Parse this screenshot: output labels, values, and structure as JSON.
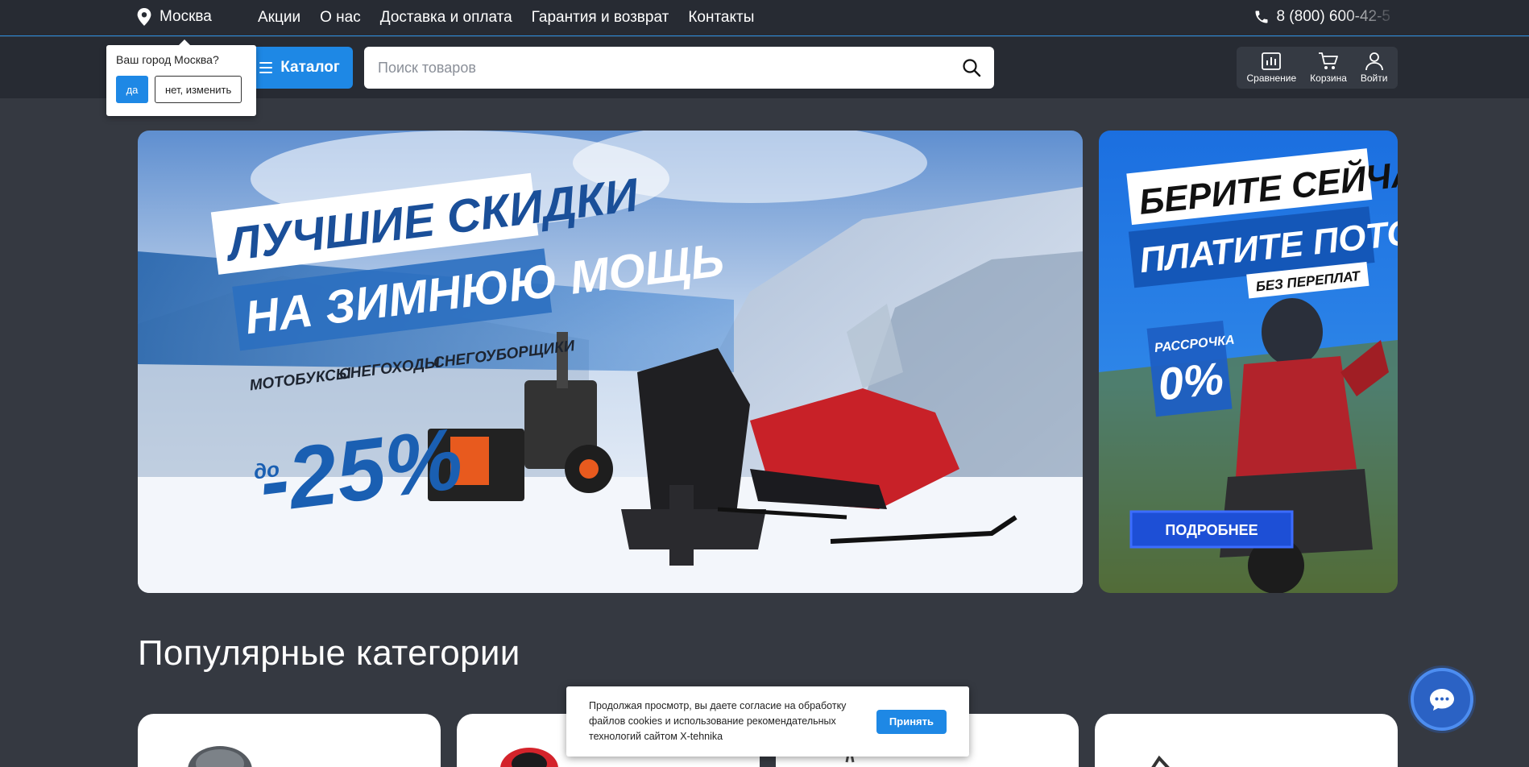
{
  "topbar": {
    "city": "Москва",
    "nav": [
      "Акции",
      "О нас",
      "Доставка и оплата",
      "Гарантия и возврат",
      "Контакты"
    ],
    "phone": "8 (800) 600-42-5"
  },
  "header": {
    "catalog_label": "Каталог",
    "search_placeholder": "Поиск товаров",
    "tools": [
      "Сравнение",
      "Корзина",
      "Войти"
    ]
  },
  "city_popup": {
    "question": "Ваш город Москва?",
    "yes_label": "да",
    "change_label": "нет, изменить"
  },
  "banner_main": {
    "line1": "ЛУЧШИЕ СКИДКИ",
    "line2": "НА ЗИМНЮЮ МОЩЬ",
    "items": [
      "МОТОБУКСЫ",
      "СНЕГОХОДЫ",
      "СНЕГОУБОРЩИКИ"
    ],
    "prefix": "до",
    "discount": "-25%"
  },
  "banner_side": {
    "line1": "БЕРИТЕ СЕЙЧАС",
    "line2": "ПЛАТИТЕ ПОТОМ",
    "line3": "БЕЗ ПЕРЕПЛАТ",
    "badge_label": "РАССРОЧКА",
    "badge_value": "0%",
    "cta": "ПОДРОБНЕЕ"
  },
  "categories": {
    "title": "Популярные категории"
  },
  "cookie": {
    "text": "Продолжая просмотр, вы даете согласие на обработку файлов cookies и использование рекомендательных технологий сайтом X-tehnika",
    "accept_label": "Принять"
  },
  "colors": {
    "accent": "#1e88e5",
    "page_bg": "#353941",
    "header_bg": "#272b33"
  },
  "icons": [
    "location-pin-icon",
    "phone-icon",
    "menu-icon",
    "search-icon",
    "compare-icon",
    "cart-icon",
    "user-icon",
    "chat-icon"
  ]
}
